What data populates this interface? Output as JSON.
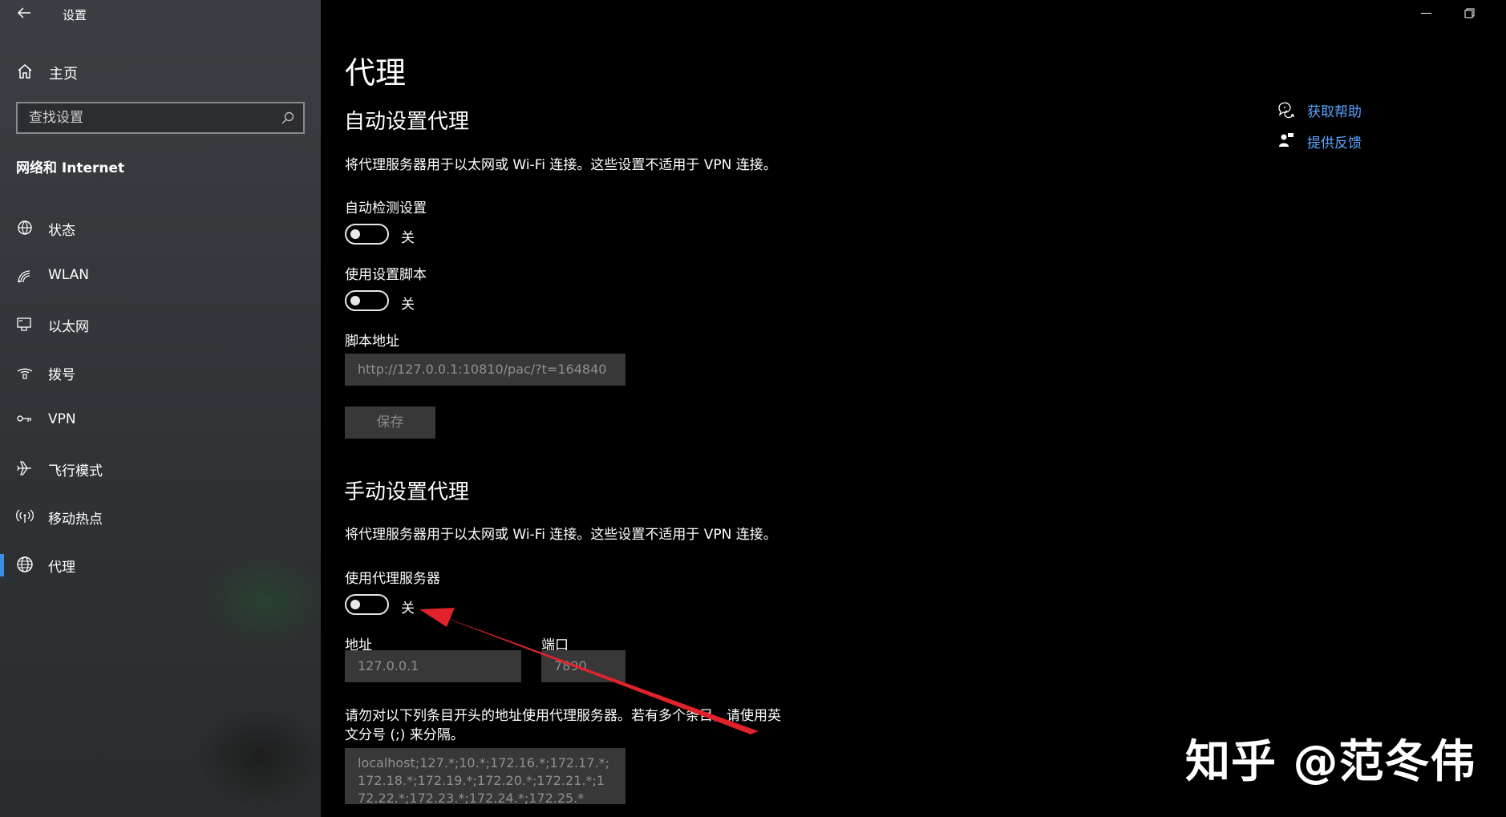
{
  "window": {
    "title": "设置"
  },
  "sidebar": {
    "home_label": "主页",
    "search_placeholder": "查找设置",
    "section_label": "网络和 Internet",
    "items": [
      {
        "label": "状态",
        "icon": "globe-status-icon"
      },
      {
        "label": "WLAN",
        "icon": "wifi-icon"
      },
      {
        "label": "以太网",
        "icon": "ethernet-icon"
      },
      {
        "label": "拨号",
        "icon": "dialup-icon"
      },
      {
        "label": "VPN",
        "icon": "vpn-icon"
      },
      {
        "label": "飞行模式",
        "icon": "airplane-icon"
      },
      {
        "label": "移动热点",
        "icon": "hotspot-icon"
      },
      {
        "label": "代理",
        "icon": "globe-icon",
        "selected": true
      }
    ]
  },
  "main": {
    "title": "代理",
    "auto": {
      "heading": "自动设置代理",
      "description": "将代理服务器用于以太网或 Wi-Fi 连接。这些设置不适用于 VPN 连接。",
      "detect_label": "自动检测设置",
      "detect_state": "关",
      "script_label": "使用设置脚本",
      "script_state": "关",
      "script_address_label": "脚本地址",
      "script_address_value": "http://127.0.0.1:10810/pac/?t=164840",
      "save_label": "保存"
    },
    "manual": {
      "heading": "手动设置代理",
      "description": "将代理服务器用于以太网或 Wi-Fi 连接。这些设置不适用于 VPN 连接。",
      "use_proxy_label": "使用代理服务器",
      "use_proxy_state": "关",
      "address_label": "地址",
      "address_value": "127.0.0.1",
      "port_label": "端口",
      "port_value": "7890",
      "exceptions_text_line1": "请勿对以下列条目开头的地址使用代理服务器。若有多个条目，请使用英",
      "exceptions_text_line2": "文分号 (;) 来分隔。",
      "exceptions_value": "localhost;127.*;10.*;172.16.*;172.17.*;172.18.*;172.19.*;172.20.*;172.21.*;172.22.*;172.23.*;172.24.*;172.25.*"
    },
    "help": {
      "get_help": "获取帮助",
      "feedback": "提供反馈"
    }
  },
  "watermark": "知乎 @范冬伟",
  "colors": {
    "accent": "#3b8eea",
    "link": "#5aa5ff",
    "annotation_arrow": "#e0232a"
  }
}
